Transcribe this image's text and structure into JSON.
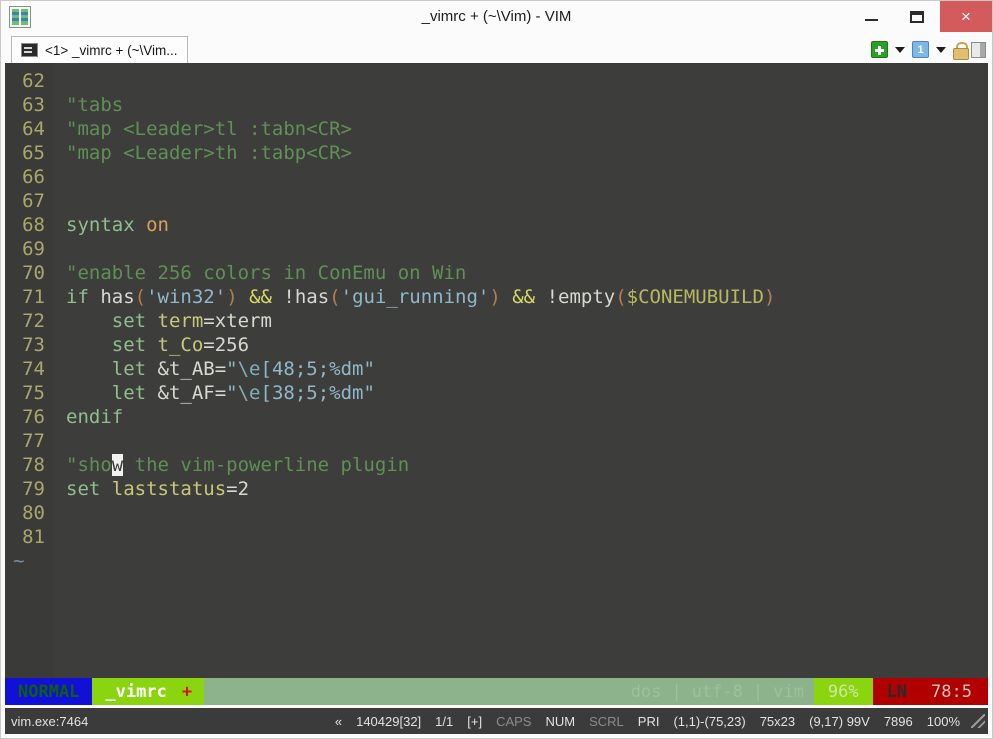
{
  "window": {
    "title": "_vimrc + (~\\Vim) - VIM",
    "app_icon": "conemu-icon",
    "minimize_label": "",
    "maximize_label": "",
    "close_label": "×"
  },
  "tabbar": {
    "tabs": [
      {
        "icon": "console-icon",
        "label": "<1> _vimrc + (~\\Vim..."
      }
    ],
    "tools": [
      {
        "name": "new-console-button",
        "icon": "green-plus-icon"
      },
      {
        "name": "new-console-dropdown",
        "icon": "chevron-down-icon"
      },
      {
        "name": "active-console-button",
        "icon": "blue-one-icon"
      },
      {
        "name": "active-console-dropdown",
        "icon": "chevron-down-icon"
      },
      {
        "name": "admin-lock-button",
        "icon": "lock-icon"
      },
      {
        "name": "split-view-button",
        "icon": "split-pane-icon"
      }
    ]
  },
  "editor": {
    "first_line": 62,
    "tilde_marker": "~",
    "lines": [
      {
        "num": "62",
        "tokens": []
      },
      {
        "num": "63",
        "tokens": [
          {
            "t": "\"tabs",
            "c": "c-comment"
          }
        ]
      },
      {
        "num": "64",
        "tokens": [
          {
            "t": "\"map <Leader>tl :tabn<CR>",
            "c": "c-comment"
          }
        ]
      },
      {
        "num": "65",
        "tokens": [
          {
            "t": "\"map <Leader>th :tabp<CR>",
            "c": "c-comment"
          }
        ]
      },
      {
        "num": "66",
        "tokens": []
      },
      {
        "num": "67",
        "tokens": []
      },
      {
        "num": "68",
        "tokens": [
          {
            "t": "syntax ",
            "c": "c-stmt"
          },
          {
            "t": "on",
            "c": "c-const"
          }
        ]
      },
      {
        "num": "69",
        "tokens": []
      },
      {
        "num": "70",
        "tokens": [
          {
            "t": "\"enable 256 colors in ConEmu on Win",
            "c": "c-comment"
          }
        ]
      },
      {
        "num": "71",
        "tokens": [
          {
            "t": "if ",
            "c": "c-stmt"
          },
          {
            "t": "has",
            "c": "c-normal"
          },
          {
            "t": "(",
            "c": "c-paren"
          },
          {
            "t": "'win32'",
            "c": "c-string"
          },
          {
            "t": ")",
            "c": "c-paren"
          },
          {
            "t": " && ",
            "c": "c-op"
          },
          {
            "t": "!has",
            "c": "c-normal"
          },
          {
            "t": "(",
            "c": "c-paren"
          },
          {
            "t": "'gui_running'",
            "c": "c-string"
          },
          {
            "t": ")",
            "c": "c-paren"
          },
          {
            "t": " && ",
            "c": "c-op"
          },
          {
            "t": "!empty",
            "c": "c-normal"
          },
          {
            "t": "(",
            "c": "c-paren"
          },
          {
            "t": "$CONEMUBUILD",
            "c": "c-env"
          },
          {
            "t": ")",
            "c": "c-paren"
          }
        ]
      },
      {
        "num": "72",
        "tokens": [
          {
            "t": "    set ",
            "c": "c-stmt"
          },
          {
            "t": "term",
            "c": "c-ident"
          },
          {
            "t": "=xterm",
            "c": "c-normal"
          }
        ]
      },
      {
        "num": "73",
        "tokens": [
          {
            "t": "    set ",
            "c": "c-stmt"
          },
          {
            "t": "t_Co",
            "c": "c-ident"
          },
          {
            "t": "=256",
            "c": "c-normal"
          }
        ]
      },
      {
        "num": "74",
        "tokens": [
          {
            "t": "    let ",
            "c": "c-stmt"
          },
          {
            "t": "&t_AB=",
            "c": "c-normal"
          },
          {
            "t": "\"",
            "c": "c-string"
          },
          {
            "t": "\\e",
            "c": "c-special"
          },
          {
            "t": "[48;5;%dm\"",
            "c": "c-string"
          }
        ]
      },
      {
        "num": "75",
        "tokens": [
          {
            "t": "    let ",
            "c": "c-stmt"
          },
          {
            "t": "&t_AF=",
            "c": "c-normal"
          },
          {
            "t": "\"",
            "c": "c-string"
          },
          {
            "t": "\\e",
            "c": "c-special"
          },
          {
            "t": "[38;5;%dm\"",
            "c": "c-string"
          }
        ]
      },
      {
        "num": "76",
        "tokens": [
          {
            "t": "endif",
            "c": "c-stmt"
          }
        ]
      },
      {
        "num": "77",
        "tokens": []
      },
      {
        "num": "78",
        "tokens": [
          {
            "t": "\"sho",
            "c": "c-comment"
          },
          {
            "t": "w",
            "c": "c-comment cursor"
          },
          {
            "t": " the vim-powerline plugin",
            "c": "c-comment"
          }
        ]
      },
      {
        "num": "79",
        "tokens": [
          {
            "t": "set ",
            "c": "c-stmt"
          },
          {
            "t": "laststatus",
            "c": "c-ident"
          },
          {
            "t": "=2",
            "c": "c-normal"
          }
        ]
      },
      {
        "num": "80",
        "tokens": []
      },
      {
        "num": "81",
        "tokens": []
      }
    ]
  },
  "statusline": {
    "mode": "NORMAL",
    "filename": "_vimrc",
    "modified_flag": "+",
    "fileformat": "dos",
    "encoding": "utf-8",
    "filetype": "vim",
    "separator": "|",
    "percent": "96%",
    "line_label": "LN",
    "position": "78:5",
    "colors": {
      "mode_bg": "#1010d8",
      "mode_fg": "#0f5f0f",
      "file_bg": "#8ad410",
      "file_fg": "#ffffff",
      "modified_fg": "#e01010",
      "fill_bg": "#8cb38c",
      "percent_bg": "#8ad410",
      "line_bg": "#b00000"
    }
  },
  "conemu_status": {
    "process": "vim.exe:7464",
    "marker": "«",
    "build": "140429[32]",
    "consoles": "1/1",
    "cursor_flag": "[+]",
    "caps": "CAPS",
    "num": "NUM",
    "scrl": "SCRL",
    "pri": "PRI",
    "selection": "(1,1)-(75,23)",
    "size": "75x23",
    "cursor": "(9,17) 99V",
    "buffer": "7896",
    "zoom": "100%"
  }
}
